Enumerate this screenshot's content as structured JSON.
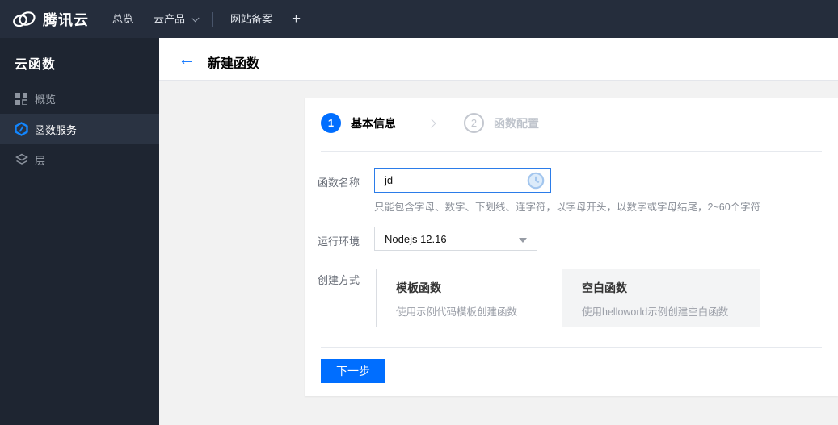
{
  "topbar": {
    "brand": "腾讯云",
    "nav_overview": "总览",
    "nav_products": "云产品",
    "nav_icp": "网站备案",
    "plus": "+"
  },
  "sidebar": {
    "title": "云函数",
    "items": [
      {
        "label": "概览",
        "icon": "grid-icon",
        "selected": false
      },
      {
        "label": "函数服务",
        "icon": "function-hexagon-icon",
        "selected": true
      },
      {
        "label": "层",
        "icon": "layers-icon",
        "selected": false
      }
    ]
  },
  "header": {
    "title": "新建函数"
  },
  "wizard": {
    "step1": {
      "number": "1",
      "label": "基本信息",
      "state": "active"
    },
    "step2": {
      "number": "2",
      "label": "函数配置",
      "state": "pending"
    }
  },
  "form": {
    "function_name": {
      "label": "函数名称",
      "value": "jd",
      "hint": "只能包含字母、数字、下划线、连字符，以字母开头，以数字或字母结尾，2~60个字符"
    },
    "runtime": {
      "label": "运行环境",
      "value": "Nodejs 12.16"
    },
    "create_method": {
      "label": "创建方式",
      "options": [
        {
          "title": "模板函数",
          "desc": "使用示例代码模板创建函数",
          "selected": false
        },
        {
          "title": "空白函数",
          "desc": "使用helloworld示例创建空白函数",
          "selected": true
        }
      ]
    }
  },
  "actions": {
    "next": "下一步"
  },
  "colors": {
    "accent": "#006eff",
    "topbar_bg": "#252d3c",
    "sidebar_bg": "#1e2531",
    "sidebar_selected_bg": "#2a3342",
    "content_bg": "#f2f2f2"
  }
}
